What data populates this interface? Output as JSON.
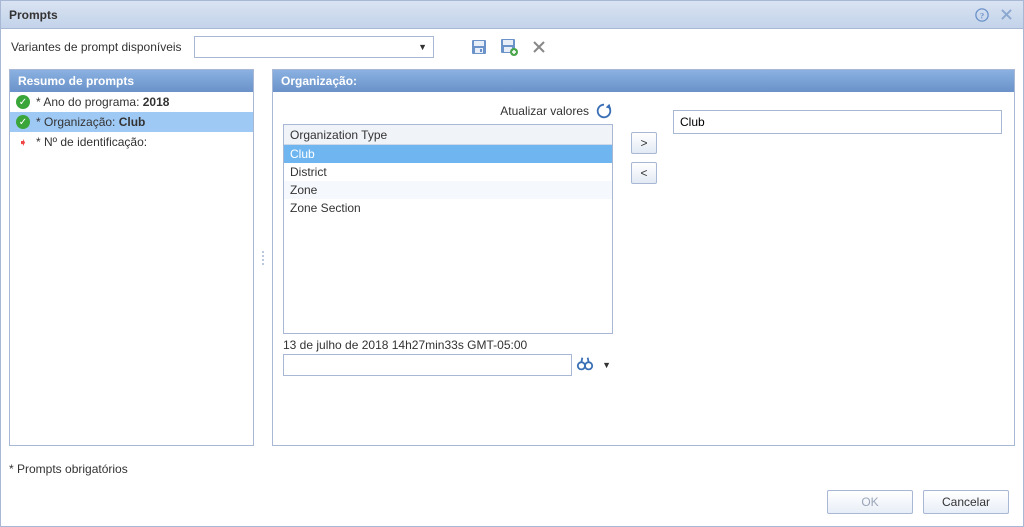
{
  "window": {
    "title": "Prompts"
  },
  "toolbar": {
    "variants_label": "Variantes de prompt disponíveis",
    "variant_value": ""
  },
  "left_panel": {
    "header": "Resumo de prompts",
    "items": [
      {
        "status": "ok",
        "label_prefix": "* Ano do programa: ",
        "value": "2018",
        "selected": false
      },
      {
        "status": "ok",
        "label_prefix": "* Organização: ",
        "value": "Club",
        "selected": true
      },
      {
        "status": "req",
        "label_prefix": "* Nº de identificação:",
        "value": "",
        "selected": false
      }
    ]
  },
  "right_panel": {
    "header": "Organização:",
    "refresh_label": "Atualizar valores",
    "column_header": "Organization Type",
    "items": [
      {
        "label": "Club",
        "selected": true
      },
      {
        "label": "District",
        "selected": false
      },
      {
        "label": "Zone",
        "selected": false
      },
      {
        "label": "Zone Section",
        "selected": false
      }
    ],
    "timestamp": "13 de julho de 2018 14h27min33s GMT-05:00",
    "selected_value": "Club",
    "search_value": ""
  },
  "footnote": "* Prompts obrigatórios",
  "buttons": {
    "ok": "OK",
    "cancel": "Cancelar"
  }
}
